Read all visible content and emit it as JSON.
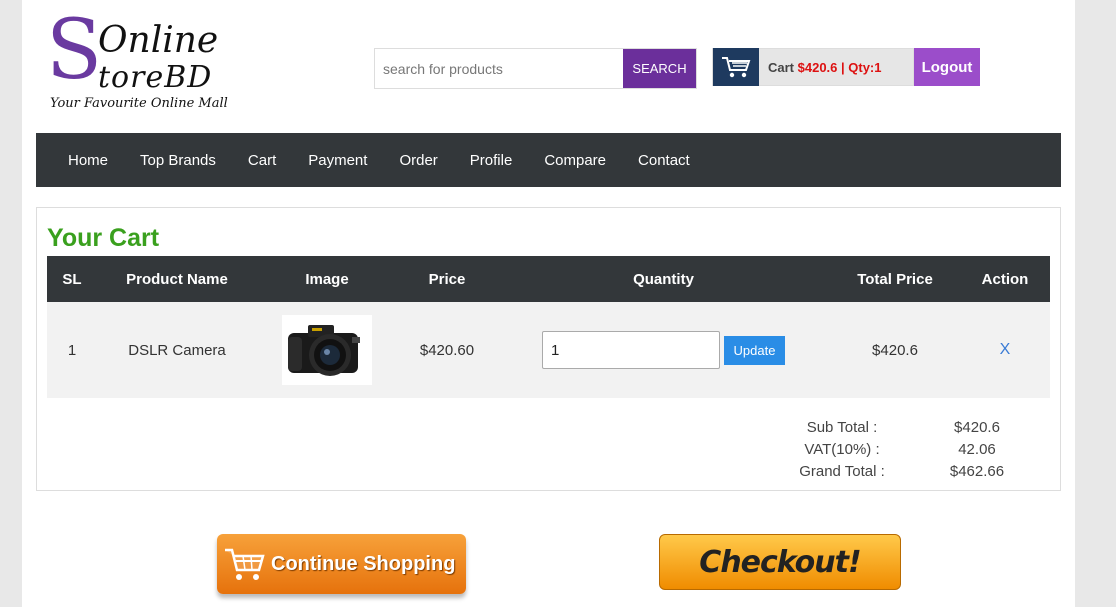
{
  "logo": {
    "letter": "S",
    "line1": "Online",
    "line2": "toreBD",
    "tagline": "Your Favourite Online Mall"
  },
  "search": {
    "placeholder": "search for products",
    "button_label": "SEARCH"
  },
  "cart_summary": {
    "label": "Cart",
    "amount_text": "$420.6 | Qty:1"
  },
  "logout_label": "Logout",
  "nav": {
    "items": [
      "Home",
      "Top Brands",
      "Cart",
      "Payment",
      "Order",
      "Profile",
      "Compare",
      "Contact"
    ]
  },
  "cart": {
    "title": "Your Cart",
    "columns": [
      "SL",
      "Product Name",
      "Image",
      "Price",
      "Quantity",
      "Total Price",
      "Action"
    ],
    "rows": [
      {
        "sl": "1",
        "name": "DSLR Camera",
        "price": "$420.60",
        "quantity": "1",
        "update_label": "Update",
        "total": "$420.6",
        "action": "X"
      }
    ],
    "totals": {
      "subtotal_label": "Sub Total :",
      "subtotal_value": "$420.6",
      "vat_label": "VAT(10%) :",
      "vat_value": "42.06",
      "grand_label": "Grand Total :",
      "grand_value": "$462.66"
    }
  },
  "buttons": {
    "continue_label": "Continue Shopping",
    "checkout_label": "Checkout!"
  },
  "colors": {
    "brand_purple": "#6b2f9b",
    "nav_dark": "#33373a",
    "title_green": "#3aa01e",
    "cart_amount_red": "#dd1111",
    "update_blue": "#2a8de6"
  }
}
